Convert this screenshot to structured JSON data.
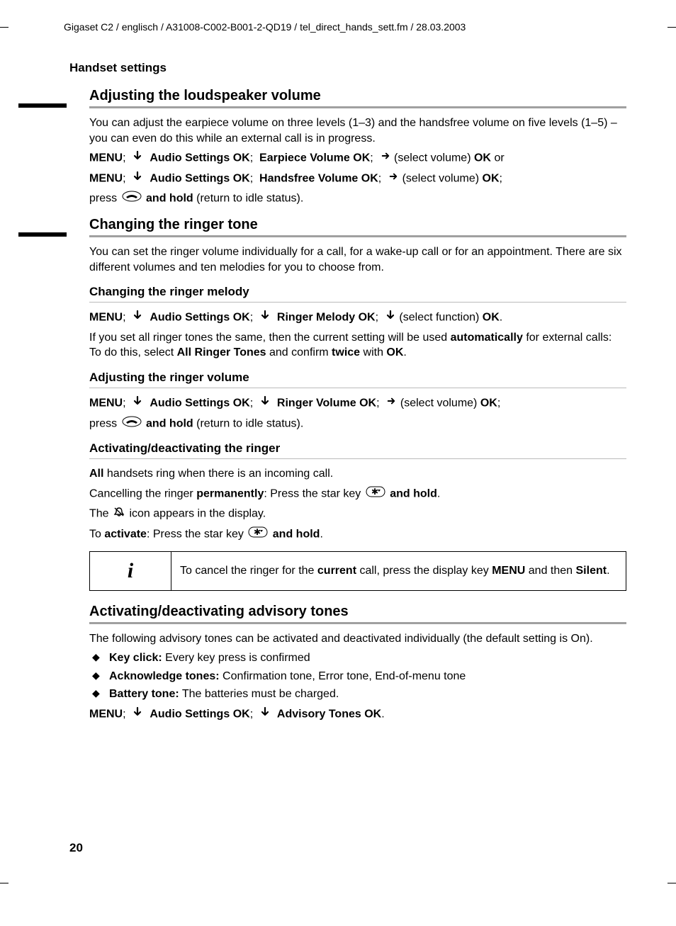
{
  "header_path": "Gigaset C2 / englisch / A31008-C002-B001-2-QD19 / tel_direct_hands_sett.fm / 28.03.2003",
  "section_title": "Handset settings",
  "s1": {
    "title": "Adjusting the loudspeaker volume",
    "p1": "You can adjust the earpiece volume on three levels (1–3) and the handsfree volume on five levels (1–5) – you can even do this while an external call is in progress.",
    "menu": "MENU",
    "audio_settings": "Audio Settings",
    "ok": "OK",
    "earpiece_volume": "Earpiece Volume",
    "select_volume": "(select volume)",
    "or": "or",
    "handsfree_volume": "Handsfree Volume",
    "press": "press",
    "and_hold": "and hold",
    "return_idle": "(return to idle status)."
  },
  "s2": {
    "title": "Changing the ringer tone",
    "p1": "You can set the ringer volume individually for a call, for a wake-up call or for an appointment. There are six different volumes and ten melodies for you to choose from.",
    "h3a": "Changing the ringer melody",
    "ringer_melody": "Ringer Melody",
    "select_function": "(select function)",
    "p2a": "If you set all ringer tones the same, then the current setting will be used ",
    "p2b": "automatically",
    "p2c": " for external calls: To do this, select ",
    "all_ringer": "All Ringer Tones",
    "p2d": " and confirm ",
    "twice": "twice",
    "p2e": " with ",
    "h3b": "Adjusting the ringer volume",
    "ringer_volume": "Ringer Volume",
    "h3c": "Activating/deactivating the ringer",
    "all": "All",
    "p3a": " handsets ring when there is an incoming call.",
    "p4a": "Cancelling the ringer ",
    "permanently": "permanently",
    "p4b": ": Press the star key ",
    "p5a": "The ",
    "p5b": " icon appears in the display.",
    "p6a": "To ",
    "activate": "activate",
    "p6b": ": Press the star key ",
    "info_a": "To cancel the ringer for the ",
    "current": "current",
    "info_b": " call, press the display key ",
    "info_c": " and then ",
    "silent": "Silent",
    "dot": "."
  },
  "s3": {
    "title": "Activating/deactivating advisory tones",
    "p1": "The following advisory tones can be activated and deactivated individually (the default setting is On).",
    "li1a": "Key click:",
    "li1b": " Every key press is confirmed",
    "li2a": "Acknowledge tones:",
    "li2b": " Confirmation tone, Error tone, End-of-menu tone",
    "li3a": "Battery tone:",
    "li3b": " The batteries must be charged.",
    "advisory_tones": "Advisory Tones"
  },
  "page_number": "20"
}
